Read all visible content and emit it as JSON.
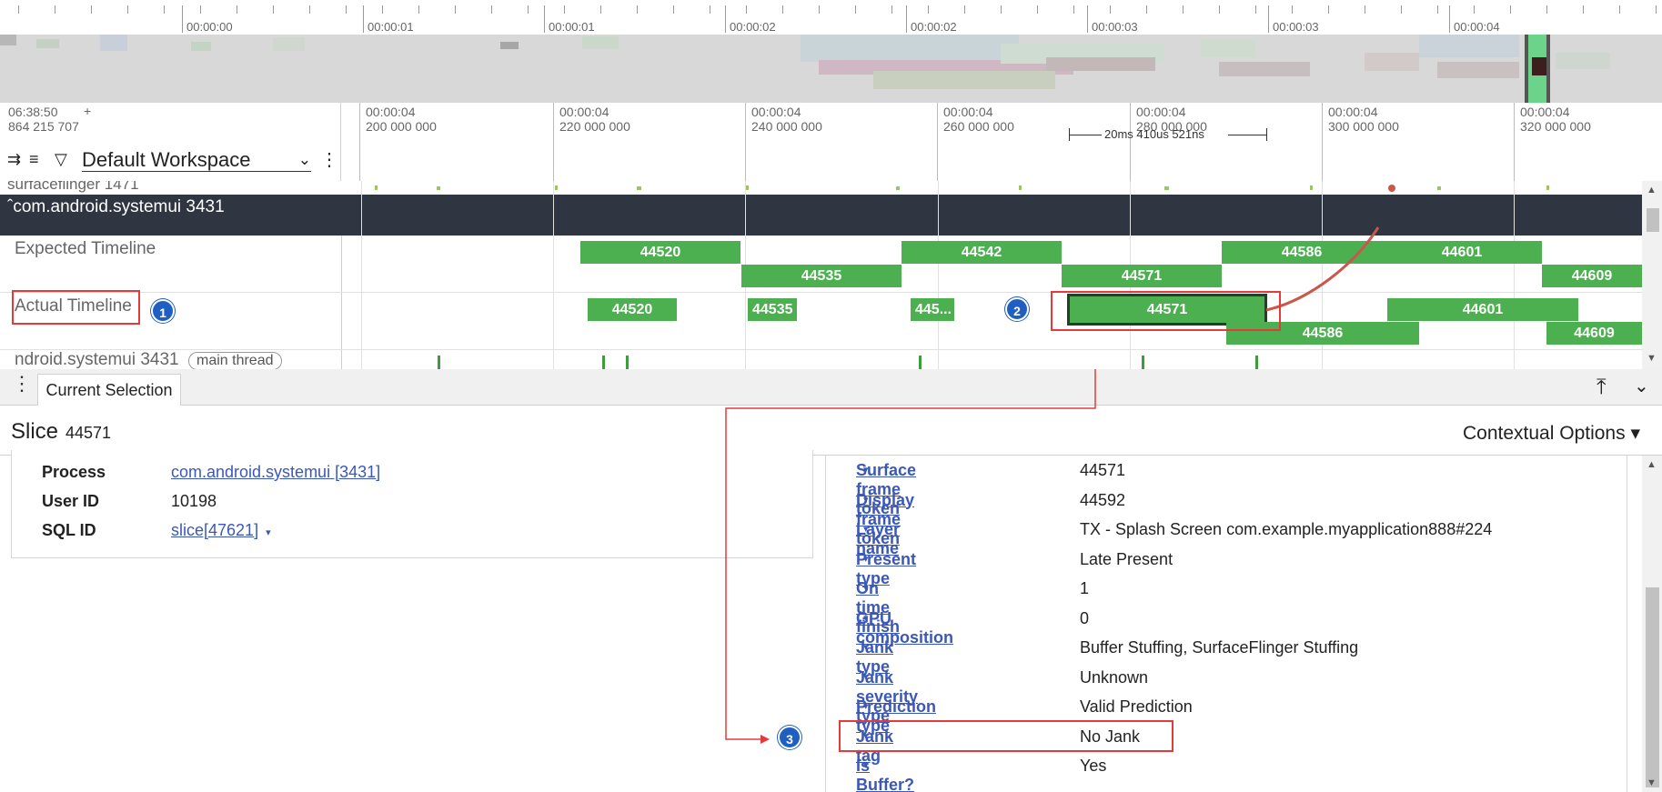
{
  "overview": {
    "labels": [
      "00:00:00",
      "00:00:01",
      "00:00:01",
      "00:00:02",
      "00:00:02",
      "00:00:03",
      "00:00:03",
      "00:00:04"
    ]
  },
  "header": {
    "time_line1": "06:38:50",
    "time_line2": "864 215 707",
    "plus": "+",
    "workspace": "Default Workspace"
  },
  "detail_ruler": {
    "ticks": [
      {
        "a": "00:00:04",
        "b": "200 000 000"
      },
      {
        "a": "00:00:04",
        "b": "220 000 000"
      },
      {
        "a": "00:00:04",
        "b": "240 000 000"
      },
      {
        "a": "00:00:04",
        "b": "260 000 000"
      },
      {
        "a": "00:00:04",
        "b": "280 000 000"
      },
      {
        "a": "00:00:04",
        "b": "300 000 000"
      },
      {
        "a": "00:00:04",
        "b": "320 000 000"
      }
    ],
    "measurement": "20ms 410us 521ns"
  },
  "tracks": {
    "surfaceflinger": "surfaceflinger 1471",
    "process": "com.android.systemui 3431",
    "expected_label": "Expected Timeline",
    "actual_label": "Actual Timeline",
    "thread_label": "ndroid.systemui 3431",
    "thread_tag": "main thread",
    "expected_slices": [
      "44520",
      "44535",
      "44542",
      "44571",
      "44586",
      "44601",
      "44609"
    ],
    "actual_slices": [
      "44520",
      "44535",
      "445...",
      "44571",
      "44586",
      "44601",
      "44609"
    ]
  },
  "panel": {
    "tab": "Current Selection",
    "slice_title": "Slice",
    "slice_id": "44571",
    "contextual": "Contextual Options",
    "left_rows": [
      {
        "k": "Process",
        "v": "com.android.systemui [3431]"
      },
      {
        "k": "User ID",
        "v": "10198"
      },
      {
        "k": "SQL ID",
        "v": "slice[47621]"
      }
    ],
    "right_rows": [
      {
        "k": "Surface frame token",
        "v": "44571"
      },
      {
        "k": "Display frame token",
        "v": "44592"
      },
      {
        "k": "Layer name",
        "v": "TX - Splash Screen com.example.myapplication888#224"
      },
      {
        "k": "Present type",
        "v": "Late Present"
      },
      {
        "k": "On time finish",
        "v": "1"
      },
      {
        "k": "GPU composition",
        "v": "0"
      },
      {
        "k": "Jank type",
        "v": "Buffer Stuffing, SurfaceFlinger Stuffing"
      },
      {
        "k": "Jank severity type",
        "v": "Unknown"
      },
      {
        "k": "Prediction type",
        "v": "Valid Prediction"
      },
      {
        "k": "Jank tag",
        "v": "No Jank"
      },
      {
        "k": "Is Buffer?",
        "v": "Yes"
      }
    ]
  },
  "badges": [
    "1",
    "2",
    "3"
  ],
  "colors": {
    "slice": "#4caf50",
    "header": "#2f3541",
    "link": "#3b58b8",
    "annotation": "#e53a3a",
    "badge": "#1f5fc2"
  }
}
